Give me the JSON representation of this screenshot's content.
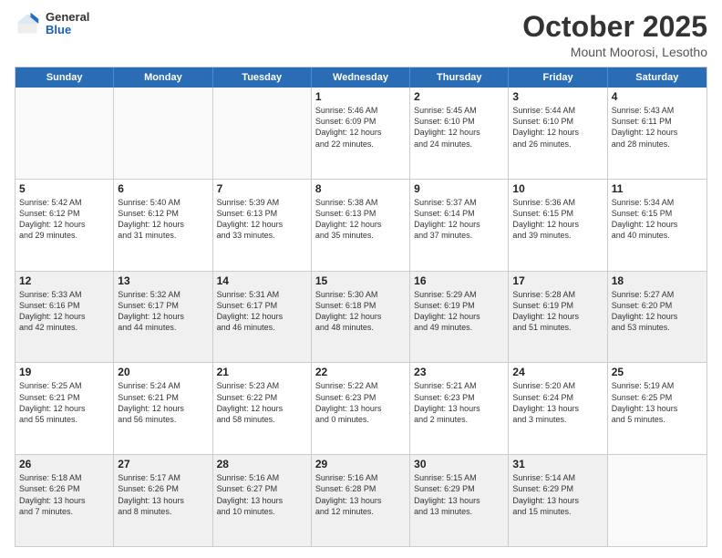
{
  "header": {
    "logo_general": "General",
    "logo_blue": "Blue",
    "month_title": "October 2025",
    "location": "Mount Moorosi, Lesotho"
  },
  "weekdays": [
    "Sunday",
    "Monday",
    "Tuesday",
    "Wednesday",
    "Thursday",
    "Friday",
    "Saturday"
  ],
  "rows": [
    [
      {
        "day": "",
        "text": "",
        "empty": true
      },
      {
        "day": "",
        "text": "",
        "empty": true
      },
      {
        "day": "",
        "text": "",
        "empty": true
      },
      {
        "day": "1",
        "text": "Sunrise: 5:46 AM\nSunset: 6:09 PM\nDaylight: 12 hours\nand 22 minutes."
      },
      {
        "day": "2",
        "text": "Sunrise: 5:45 AM\nSunset: 6:10 PM\nDaylight: 12 hours\nand 24 minutes."
      },
      {
        "day": "3",
        "text": "Sunrise: 5:44 AM\nSunset: 6:10 PM\nDaylight: 12 hours\nand 26 minutes."
      },
      {
        "day": "4",
        "text": "Sunrise: 5:43 AM\nSunset: 6:11 PM\nDaylight: 12 hours\nand 28 minutes."
      }
    ],
    [
      {
        "day": "5",
        "text": "Sunrise: 5:42 AM\nSunset: 6:12 PM\nDaylight: 12 hours\nand 29 minutes."
      },
      {
        "day": "6",
        "text": "Sunrise: 5:40 AM\nSunset: 6:12 PM\nDaylight: 12 hours\nand 31 minutes."
      },
      {
        "day": "7",
        "text": "Sunrise: 5:39 AM\nSunset: 6:13 PM\nDaylight: 12 hours\nand 33 minutes."
      },
      {
        "day": "8",
        "text": "Sunrise: 5:38 AM\nSunset: 6:13 PM\nDaylight: 12 hours\nand 35 minutes."
      },
      {
        "day": "9",
        "text": "Sunrise: 5:37 AM\nSunset: 6:14 PM\nDaylight: 12 hours\nand 37 minutes."
      },
      {
        "day": "10",
        "text": "Sunrise: 5:36 AM\nSunset: 6:15 PM\nDaylight: 12 hours\nand 39 minutes."
      },
      {
        "day": "11",
        "text": "Sunrise: 5:34 AM\nSunset: 6:15 PM\nDaylight: 12 hours\nand 40 minutes."
      }
    ],
    [
      {
        "day": "12",
        "text": "Sunrise: 5:33 AM\nSunset: 6:16 PM\nDaylight: 12 hours\nand 42 minutes.",
        "shaded": true
      },
      {
        "day": "13",
        "text": "Sunrise: 5:32 AM\nSunset: 6:17 PM\nDaylight: 12 hours\nand 44 minutes.",
        "shaded": true
      },
      {
        "day": "14",
        "text": "Sunrise: 5:31 AM\nSunset: 6:17 PM\nDaylight: 12 hours\nand 46 minutes.",
        "shaded": true
      },
      {
        "day": "15",
        "text": "Sunrise: 5:30 AM\nSunset: 6:18 PM\nDaylight: 12 hours\nand 48 minutes.",
        "shaded": true
      },
      {
        "day": "16",
        "text": "Sunrise: 5:29 AM\nSunset: 6:19 PM\nDaylight: 12 hours\nand 49 minutes.",
        "shaded": true
      },
      {
        "day": "17",
        "text": "Sunrise: 5:28 AM\nSunset: 6:19 PM\nDaylight: 12 hours\nand 51 minutes.",
        "shaded": true
      },
      {
        "day": "18",
        "text": "Sunrise: 5:27 AM\nSunset: 6:20 PM\nDaylight: 12 hours\nand 53 minutes.",
        "shaded": true
      }
    ],
    [
      {
        "day": "19",
        "text": "Sunrise: 5:25 AM\nSunset: 6:21 PM\nDaylight: 12 hours\nand 55 minutes."
      },
      {
        "day": "20",
        "text": "Sunrise: 5:24 AM\nSunset: 6:21 PM\nDaylight: 12 hours\nand 56 minutes."
      },
      {
        "day": "21",
        "text": "Sunrise: 5:23 AM\nSunset: 6:22 PM\nDaylight: 12 hours\nand 58 minutes."
      },
      {
        "day": "22",
        "text": "Sunrise: 5:22 AM\nSunset: 6:23 PM\nDaylight: 13 hours\nand 0 minutes."
      },
      {
        "day": "23",
        "text": "Sunrise: 5:21 AM\nSunset: 6:23 PM\nDaylight: 13 hours\nand 2 minutes."
      },
      {
        "day": "24",
        "text": "Sunrise: 5:20 AM\nSunset: 6:24 PM\nDaylight: 13 hours\nand 3 minutes."
      },
      {
        "day": "25",
        "text": "Sunrise: 5:19 AM\nSunset: 6:25 PM\nDaylight: 13 hours\nand 5 minutes."
      }
    ],
    [
      {
        "day": "26",
        "text": "Sunrise: 5:18 AM\nSunset: 6:26 PM\nDaylight: 13 hours\nand 7 minutes.",
        "shaded": true
      },
      {
        "day": "27",
        "text": "Sunrise: 5:17 AM\nSunset: 6:26 PM\nDaylight: 13 hours\nand 8 minutes.",
        "shaded": true
      },
      {
        "day": "28",
        "text": "Sunrise: 5:16 AM\nSunset: 6:27 PM\nDaylight: 13 hours\nand 10 minutes.",
        "shaded": true
      },
      {
        "day": "29",
        "text": "Sunrise: 5:16 AM\nSunset: 6:28 PM\nDaylight: 13 hours\nand 12 minutes.",
        "shaded": true
      },
      {
        "day": "30",
        "text": "Sunrise: 5:15 AM\nSunset: 6:29 PM\nDaylight: 13 hours\nand 13 minutes.",
        "shaded": true
      },
      {
        "day": "31",
        "text": "Sunrise: 5:14 AM\nSunset: 6:29 PM\nDaylight: 13 hours\nand 15 minutes.",
        "shaded": true
      },
      {
        "day": "",
        "text": "",
        "empty": true,
        "shaded": true
      }
    ]
  ]
}
